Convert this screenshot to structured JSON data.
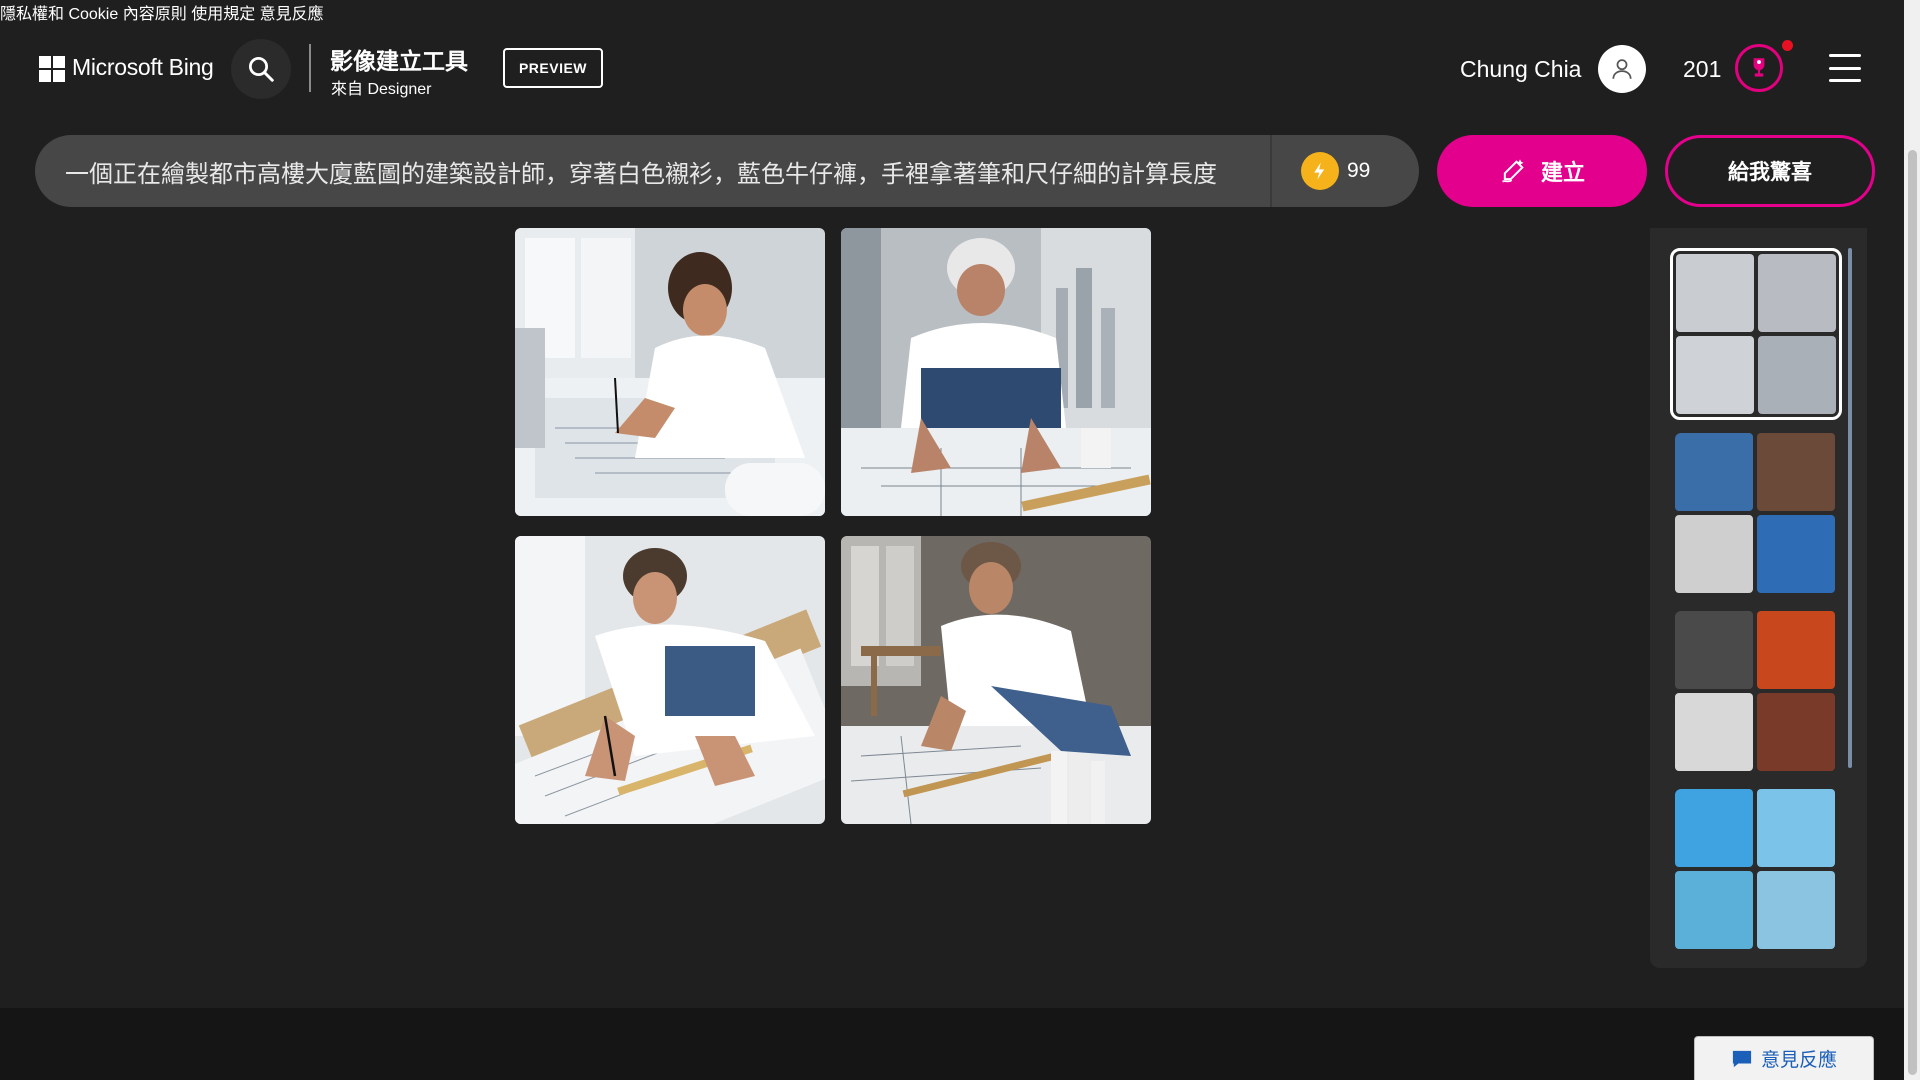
{
  "header": {
    "brand": "Microsoft Bing",
    "app_title": "影像建立工具",
    "app_subtitle": "來自 Designer",
    "preview_badge": "PREVIEW",
    "user_name": "Chung Chia",
    "rewards_points": "201"
  },
  "prompt": {
    "text": "一個正在繪製都市高樓大廈藍圖的建築設計師，穿著白色襯衫，藍色牛仔褲，手裡拿著筆和尺仔細的計算長度",
    "boosts_remaining": "99",
    "create_label": "建立",
    "surprise_label": "給我驚喜"
  },
  "images": [
    {
      "name": "generated-image-1",
      "subject": "architect-drafting-blueprint"
    },
    {
      "name": "generated-image-2",
      "subject": "gray-haired-architect-at-window"
    },
    {
      "name": "generated-image-3",
      "subject": "architect-with-ruler"
    },
    {
      "name": "generated-image-4",
      "subject": "bearded-architect-kneeling"
    }
  ],
  "history": [
    {
      "name": "history-architect",
      "selected": true,
      "colors": [
        "#c9ccd0",
        "#b8bcc2",
        "#cfd2d6",
        "#aab0b8"
      ]
    },
    {
      "name": "history-fisheye-portrait",
      "selected": false,
      "colors": [
        "#3a6ea8",
        "#6b4a3a",
        "#cfcfcf",
        "#2e6db5"
      ]
    },
    {
      "name": "history-fisheye-dark",
      "selected": false,
      "colors": [
        "#4a4a4a",
        "#c8471c",
        "#d8d8d8",
        "#7a3a2a"
      ]
    },
    {
      "name": "history-cartoon-alien",
      "selected": false,
      "colors": [
        "#3ea3e0",
        "#7cc3ea",
        "#5ab0d8",
        "#8ac4e0"
      ]
    }
  ],
  "footer": {
    "privacy": "隱私權和 Cookie",
    "content_policy": "內容原則",
    "terms": "使用規定",
    "feedback": "意見反應",
    "feedback_button": "意見反應"
  },
  "colors": {
    "accent": "#e3008c",
    "background": "#1f1f1f",
    "prompt_bar": "#474747",
    "boost": "#f5b21a"
  },
  "icons": [
    "search-icon",
    "user-icon",
    "trophy-icon",
    "menu-icon",
    "boost-icon",
    "pen-icon",
    "chat-icon"
  ]
}
